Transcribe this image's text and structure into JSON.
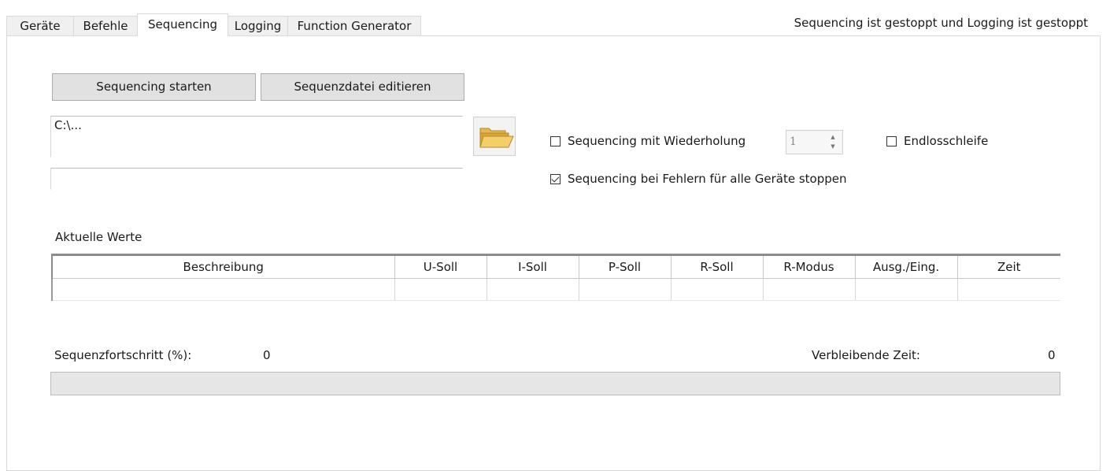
{
  "tabs": [
    {
      "label": "Geräte",
      "active": false
    },
    {
      "label": "Befehle",
      "active": false
    },
    {
      "label": "Sequencing",
      "active": true
    },
    {
      "label": "Logging",
      "active": false
    },
    {
      "label": "Function Generator",
      "active": false
    }
  ],
  "status_text": "Sequencing ist gestoppt und Logging ist gestoppt",
  "buttons": {
    "start": "Sequencing starten",
    "edit": "Sequenzdatei editieren"
  },
  "file_path": "C:\\...",
  "second_field": "",
  "folder_icon": "folder-open-icon",
  "options": {
    "repeat_label": "Sequencing mit Wiederholung",
    "repeat_checked": false,
    "repeat_count": "1",
    "endless_label": "Endlosschleife",
    "endless_checked": false,
    "stop_on_error_label": "Sequencing bei Fehlern für alle Geräte stoppen",
    "stop_on_error_checked": true
  },
  "current_values": {
    "title": "Aktuelle Werte",
    "columns": [
      "Beschreibung",
      "U-Soll",
      "I-Soll",
      "P-Soll",
      "R-Soll",
      "R-Modus",
      "Ausg./Eing.",
      "Zeit"
    ],
    "rows": [
      [
        "",
        "",
        "",
        "",
        "",
        "",
        "",
        ""
      ]
    ]
  },
  "progress": {
    "label": "Sequenzfortschritt (%):",
    "value": "0",
    "percent": 0,
    "remaining_label": "Verbleibende Zeit:",
    "remaining_value": "0"
  },
  "colors": {
    "progress_fill": "#06b025",
    "button_bg": "#e1e1e1"
  }
}
